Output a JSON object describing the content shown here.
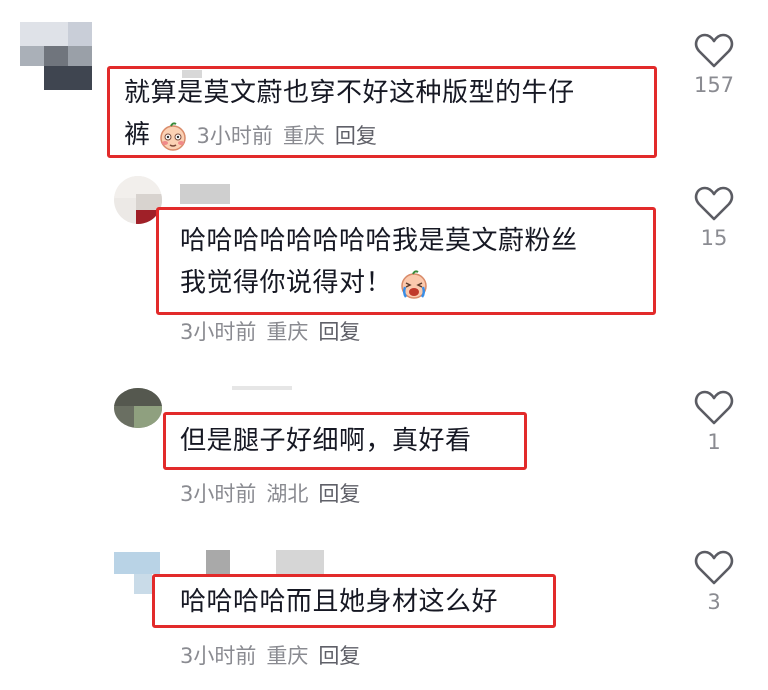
{
  "comments": [
    {
      "text_line1": "就算是莫文蔚也穿不好这种版型的牛仔",
      "text_line2": "裤",
      "emoji": "blushing-face-emoji",
      "time": "3小时前",
      "location": "重庆",
      "reply_label": "回复",
      "likes": "157"
    },
    {
      "text_line1": "哈哈哈哈哈哈哈哈我是莫文蔚粉丝",
      "text_line2": "我觉得你说得对！",
      "emoji": "laughing-crying-emoji",
      "time": "3小时前",
      "location": "重庆",
      "reply_label": "回复",
      "likes": "15"
    },
    {
      "text_line1": "但是腿子好细啊，真好看",
      "time": "3小时前",
      "location": "湖北",
      "reply_label": "回复",
      "likes": "1"
    },
    {
      "text_line1": "哈哈哈哈而且她身材这么好",
      "time": "3小时前",
      "location": "重庆",
      "reply_label": "回复",
      "likes": "3"
    }
  ],
  "colors": {
    "highlight_border": "#e22a2a",
    "meta_text": "#8a8b91",
    "heart_stroke": "#5b5c63"
  }
}
